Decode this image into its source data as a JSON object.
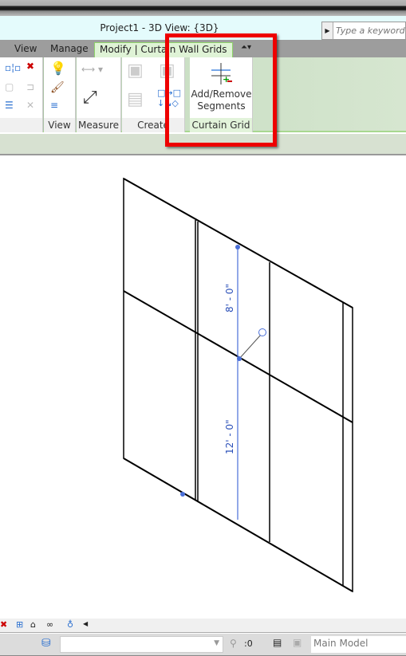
{
  "window": {
    "title": "Project1 - 3D View: {3D}",
    "search_placeholder": "Type a keyword or"
  },
  "tabs": [
    {
      "label": "View"
    },
    {
      "label": "Manage"
    },
    {
      "label": "Modify | Curtain Wall Grids",
      "active": true
    }
  ],
  "ribbon": {
    "panels": [
      {
        "label": ""
      },
      {
        "label": "View"
      },
      {
        "label": "Measure"
      },
      {
        "label": "Create"
      },
      {
        "label": "Curtain Grid"
      }
    ],
    "add_remove_segments": "Add/Remove\nSegments"
  },
  "canvas": {
    "dimensions": [
      "8' - 0\"",
      "12' - 0\""
    ],
    "selection_color": "#4a6fd8"
  },
  "status": {
    "worksets_value": "",
    "filter_count": ":0",
    "model": "Main Model"
  },
  "highlight_color": "#e00000"
}
